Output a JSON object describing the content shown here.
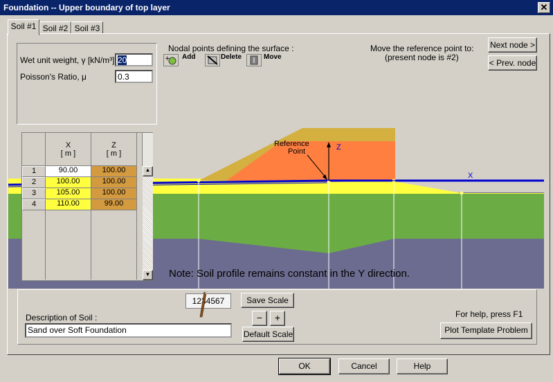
{
  "window": {
    "title": "Foundation -- Upper boundary of top layer",
    "close_glyph": "✕"
  },
  "tabs": [
    {
      "label": "Soil #1"
    },
    {
      "label": "Soil #2"
    },
    {
      "label": "Soil #3"
    }
  ],
  "properties": {
    "unit_weight_label": "Wet unit weight, γ [kN/m³]",
    "unit_weight_value": "20",
    "poisson_label": "Poisson's Ratio,  μ",
    "poisson_value": "0.3"
  },
  "nodal": {
    "heading": "Nodal points defining the surface :",
    "add_label": "Add",
    "delete_label": "Delete",
    "move_label": "Move"
  },
  "reference": {
    "line1": "Move the reference point to:",
    "line2": "(present node is #2)",
    "next_label": "Next node >",
    "prev_label": "< Prev. node"
  },
  "table": {
    "x_header": "X",
    "z_header": "Z",
    "unit": "[ m ]",
    "rows": [
      {
        "n": "1",
        "x": "90.00",
        "z": "100.00"
      },
      {
        "n": "2",
        "x": "100.00",
        "z": "100.00"
      },
      {
        "n": "3",
        "x": "105.00",
        "z": "100.00"
      },
      {
        "n": "4",
        "x": "110.00",
        "z": "99.00"
      }
    ]
  },
  "plot": {
    "ref_label_1": "Reference",
    "ref_label_2": "Point",
    "z_axis": "Z",
    "x_axis": "X",
    "note": "Note: Soil profile remains constant in the Y direction."
  },
  "bottom": {
    "scale_text": "1234567",
    "save_scale": "Save Scale",
    "default_scale": "Default Scale",
    "desc_label": "Description of Soil :",
    "desc_value": "Sand over Soft Foundation",
    "help_hint": "For help, press F1",
    "plot_template": "Plot Template Problem",
    "zoom_out_glyph": "−",
    "zoom_in_glyph": "+"
  },
  "footer": {
    "ok": "OK",
    "cancel": "Cancel",
    "help": "Help"
  },
  "colors": {
    "sand": "#ffff40",
    "embankment": "#ff7f40",
    "embankment_top": "#d4b040",
    "green_layer": "#6cac44",
    "foundation": "#6c6c90",
    "surface_line": "#0000d0"
  }
}
